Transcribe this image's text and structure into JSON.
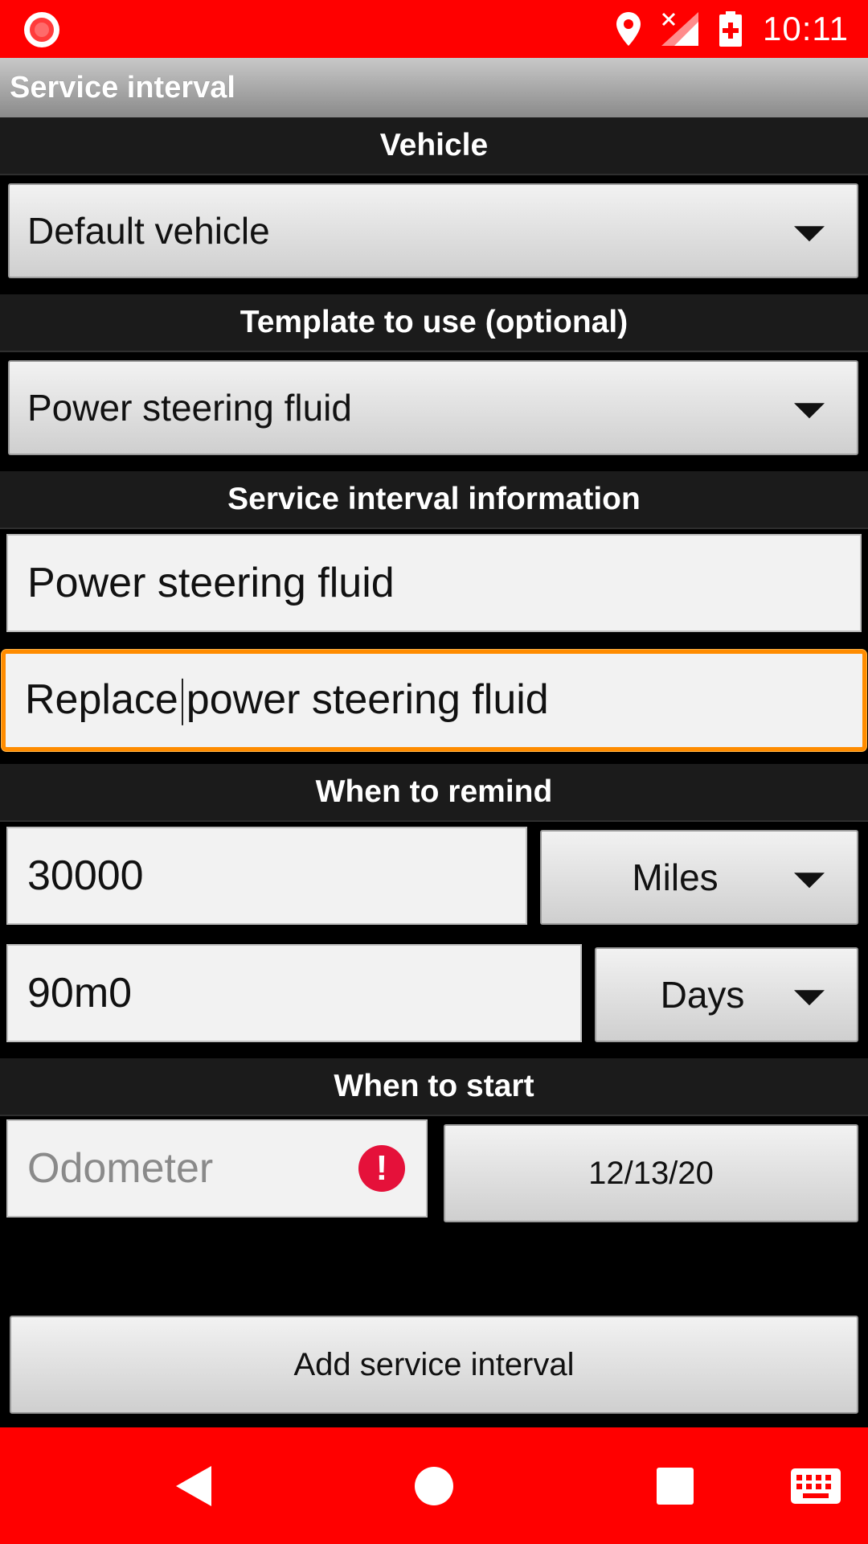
{
  "status_bar": {
    "time": "10:11",
    "icons": [
      "record-icon",
      "location-icon",
      "signal-no-data-icon",
      "battery-charging-icon"
    ]
  },
  "title_bar": {
    "title": "Service interval"
  },
  "sections": {
    "vehicle": "Vehicle",
    "template": "Template to use (optional)",
    "info": "Service interval information",
    "remind": "When to remind",
    "start": "When to start"
  },
  "vehicle_spinner": {
    "selected": "Default vehicle"
  },
  "template_spinner": {
    "selected": "Power steering fluid"
  },
  "info": {
    "name_value": "Power steering fluid",
    "description_before_cursor": "Replace",
    "description_after_cursor": "power steering fluid"
  },
  "remind": {
    "distance_value": "30000",
    "distance_unit": "Miles",
    "time_value": "90m0",
    "time_unit": "Days"
  },
  "start": {
    "odometer_placeholder": "Odometer",
    "odometer_error": "!",
    "date": "12/13/20"
  },
  "add_button": "Add service interval",
  "colors": {
    "status_bar": "#ff0000",
    "nav_bar": "#ff0000",
    "focus_border": "#ff8c00",
    "error": "#e5113a"
  }
}
